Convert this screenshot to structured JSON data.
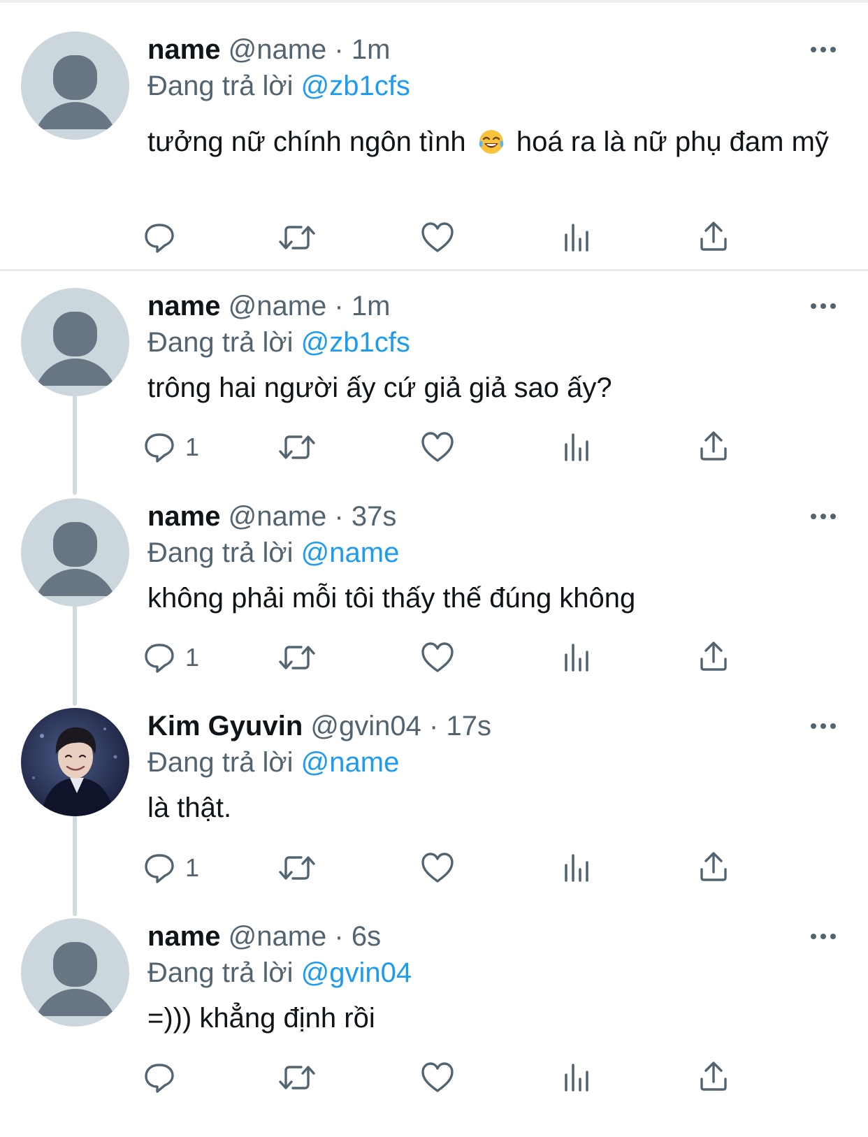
{
  "tweets": [
    {
      "name": "name",
      "handle": "@name",
      "sep": "·",
      "time": "1m",
      "reply_prefix": "Đang trả lời",
      "reply_to": "@zb1cfs",
      "text_a": "tưởng nữ chính ngôn tình",
      "emoji": "face-with-tears-of-joy",
      "text_b": "hoá ra là nữ phụ đam mỹ",
      "reply_count": "",
      "avatar": "default-avatar"
    },
    {
      "name": "name",
      "handle": "@name",
      "sep": "·",
      "time": "1m",
      "reply_prefix": "Đang trả lời",
      "reply_to": "@zb1cfs",
      "text": "trông hai người ấy cứ giả giả sao ấy?",
      "reply_count": "1",
      "avatar": "default-avatar"
    },
    {
      "name": "name",
      "handle": "@name",
      "sep": "·",
      "time": "37s",
      "reply_prefix": "Đang trả lời",
      "reply_to": "@name",
      "text": "không phải mỗi tôi thấy thế đúng không",
      "reply_count": "1",
      "avatar": "default-avatar"
    },
    {
      "name": "Kim Gyuvin",
      "handle": "@gvin04",
      "sep": "·",
      "time": "17s",
      "reply_prefix": "Đang trả lời",
      "reply_to": "@name",
      "text": "là thật.",
      "reply_count": "1",
      "avatar": "profile-photo"
    },
    {
      "name": "name",
      "handle": "@name",
      "sep": "·",
      "time": "6s",
      "reply_prefix": "Đang trả lời",
      "reply_to": "@gvin04",
      "text": "=))) khẳng định rồi",
      "reply_count": "",
      "avatar": "default-avatar"
    }
  ],
  "icons": {
    "reply": "reply-icon",
    "retweet": "retweet-icon",
    "like": "heart-icon",
    "views": "views-icon",
    "share": "share-icon",
    "more": "more-icon"
  },
  "colors": {
    "mention": "#1d9bf0",
    "secondary_text": "#536471",
    "primary_text": "#0f1419",
    "default_avatar_bg": "#ccd6dd",
    "default_avatar_figure": "#687684"
  }
}
